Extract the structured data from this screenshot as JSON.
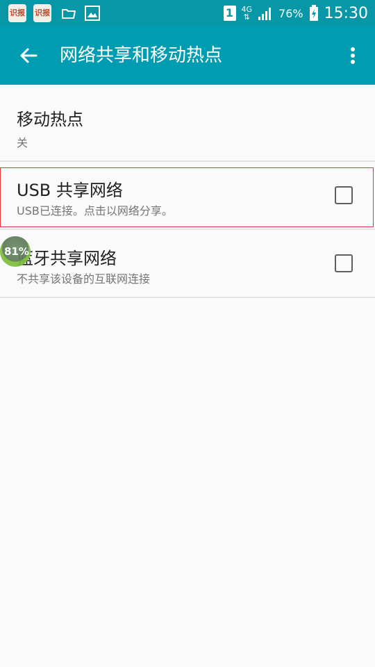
{
  "status_bar": {
    "app_icon_1": "识报",
    "app_icon_2": "识报",
    "notification_icons": [
      "folder-icon",
      "image-icon"
    ],
    "sim_badge": "1",
    "network_type": "4G",
    "signal_icon": "signal-icon",
    "battery_percent": "76%",
    "battery_icon": "battery-charging-icon",
    "time": "15:30"
  },
  "app_bar": {
    "back_icon": "back-arrow-icon",
    "title": "网络共享和移动热点",
    "overflow_icon": "more-vert-icon"
  },
  "items": [
    {
      "title": "移动热点",
      "subtitle": "关"
    },
    {
      "title": "USB 共享网络",
      "subtitle": "USB已连接。点击以网络分享。",
      "checked": false
    },
    {
      "title": "蓝牙共享网络",
      "subtitle": "不共享该设备的互联网连接",
      "checked": false
    }
  ],
  "floating_bubble": {
    "text": "81%"
  },
  "colors": {
    "status_bar": "#0797a6",
    "app_bar": "#009db2",
    "background": "#fafafa",
    "highlight_border": "#e0373b"
  }
}
